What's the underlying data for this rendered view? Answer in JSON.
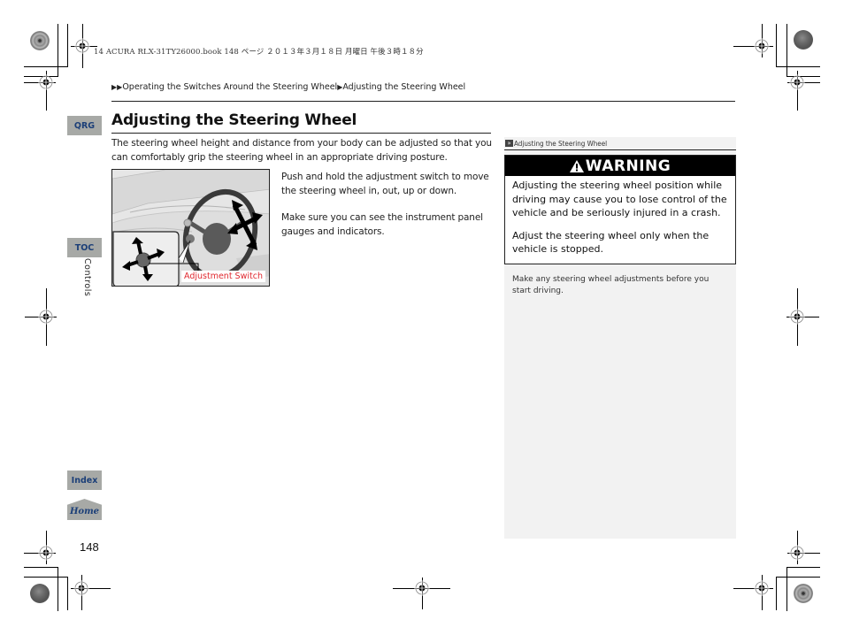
{
  "print_header": "14 ACURA RLX-31TY26000.book  148 ページ  ２０１３年３月１８日  月曜日  午後３時１８分",
  "breadcrumb": {
    "items": [
      "Operating the Switches Around the Steering Wheel",
      "Adjusting the Steering Wheel"
    ],
    "separator_icon": "right-triangle-icon"
  },
  "side_tabs": {
    "qrg": "QRG",
    "toc": "TOC",
    "section": "Controls",
    "index": "Index",
    "home": "Home"
  },
  "page_number": "148",
  "main": {
    "title": "Adjusting the Steering Wheel",
    "intro": "The steering wheel height and distance from your body can be adjusted so that you can comfortably grip the steering wheel in an appropriate driving posture.",
    "figure_caption": "Adjustment Switch",
    "steps": [
      "Push and hold the adjustment switch to move the steering wheel in, out, up or down.",
      "Make sure you can see the instrument panel gauges and indicators."
    ]
  },
  "sidebar": {
    "reference": "Adjusting the Steering Wheel",
    "warning": {
      "heading": "WARNING",
      "paragraphs": [
        "Adjusting the steering wheel position while driving may cause you to lose control of the vehicle and be seriously injured in a crash.",
        "Adjust the steering wheel only when the vehicle is stopped."
      ]
    },
    "note": "Make any steering wheel adjustments before you start driving."
  },
  "colors": {
    "tab_bg": "#a7a9a6",
    "tab_text": "#1c3f78",
    "caption_red": "#e0282f",
    "sidebar_bg": "#f2f2f2",
    "warning_bg": "#000000"
  }
}
